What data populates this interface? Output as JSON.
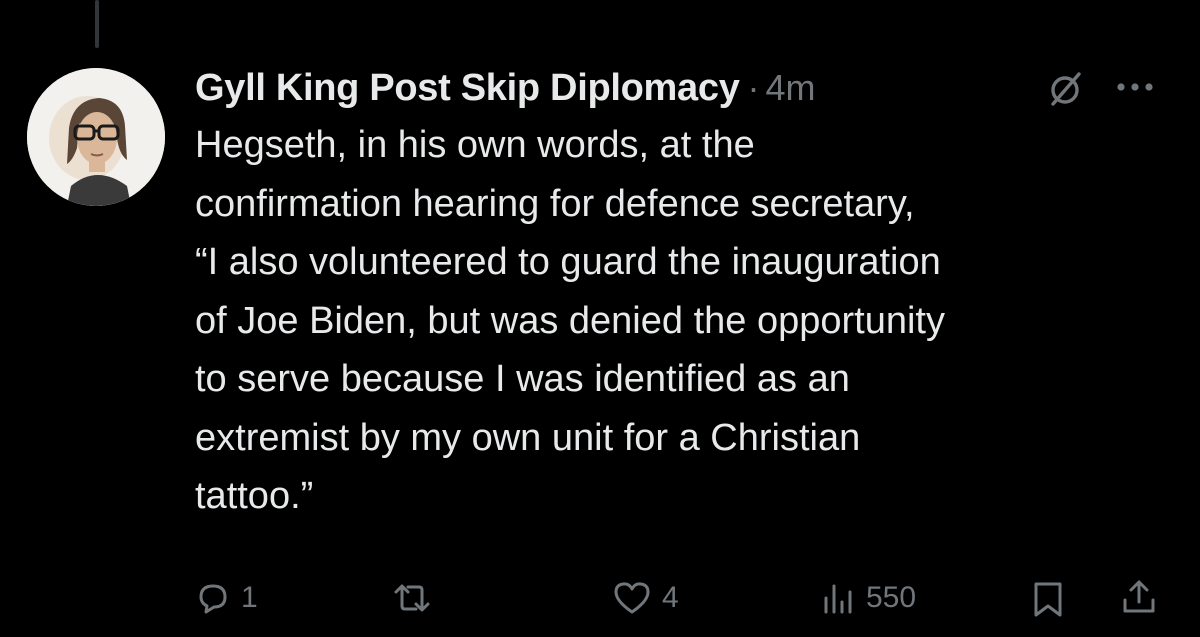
{
  "post": {
    "author_name": "Gyll King Post Skip Diplomacy",
    "separator": "·",
    "time": "4m",
    "text": "Hegseth, in his own words,  at the\nconfirmation hearing for defence secretary,\n“I also volunteered to guard the inauguration\nof Joe Biden, but was denied the opportunity\nto serve because I was identified as an\nextremist by my own unit for a Christian\ntattoo.”"
  },
  "icons": {
    "grok": "grok-icon",
    "more": "more-icon",
    "reply": "reply-icon",
    "repost": "repost-icon",
    "like": "heart-icon",
    "views": "views-icon",
    "bookmark": "bookmark-icon",
    "share": "share-icon"
  },
  "actions": {
    "reply_count": "1",
    "repost_count": "",
    "like_count": "4",
    "views_count": "550"
  },
  "colors": {
    "background": "#000000",
    "primary_text": "#e7e9ea",
    "secondary_text": "#71767b"
  }
}
